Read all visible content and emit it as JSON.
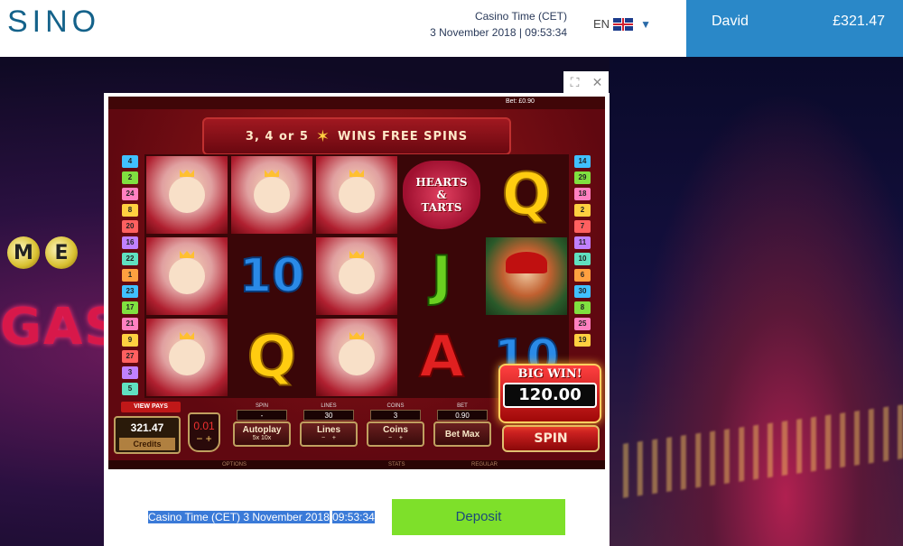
{
  "header": {
    "logo_text": "SINO",
    "casino_time_label": "Casino Time (CET)",
    "casino_time_value": "3 November 2018 | 09:53:34",
    "language": "EN",
    "username": "David",
    "balance": "£321.47"
  },
  "game": {
    "banner_prefix": "3, 4 or 5",
    "banner_suffix": "WINS FREE SPINS",
    "paylines_left": [
      "4",
      "2",
      "24",
      "8",
      "20",
      "16",
      "22",
      "1",
      "23",
      "17",
      "21",
      "9",
      "27",
      "3",
      "5"
    ],
    "paylines_right": [
      "14",
      "29",
      "18",
      "2",
      "7",
      "11",
      "10",
      "6",
      "30",
      "8",
      "25",
      "19"
    ],
    "hearts_logo_line1": "HEARTS",
    "hearts_logo_line2": "&",
    "hearts_logo_line3": "TARTS",
    "view_pays": "VIEW PAYS",
    "credits_value": "321.47",
    "credits_label": "Credits",
    "coin_value": "0.01",
    "spin_caption": "SPIN",
    "lines_caption": "LINES",
    "coins_caption": "COINS",
    "bet_caption": "BET",
    "spin_value": "-",
    "lines_value": "30",
    "coins_value": "3",
    "bet_value": "0.90",
    "autoplay_label": "Autoplay",
    "autoplay_opts": "5x    10x",
    "lines_label": "Lines",
    "coins_label": "Coins",
    "betmax_label": "Bet Max",
    "spin_label": "SPIN",
    "big_win_label": "BIG WIN!",
    "big_win_value": "120.00",
    "bottom_options": "OPTIONS",
    "bottom_stats": "STATS",
    "bottom_regular": "REGULAR"
  },
  "footer": {
    "time_text_1": "Casino Time (CET) 3 November 2018",
    "time_text_2": "09:53:34",
    "deposit_label": "Deposit"
  },
  "colors": {
    "header_bg": "#ffffff",
    "account_bg": "#2a88c8",
    "deposit_bg": "#7ee02a",
    "logo": "#14628a"
  }
}
